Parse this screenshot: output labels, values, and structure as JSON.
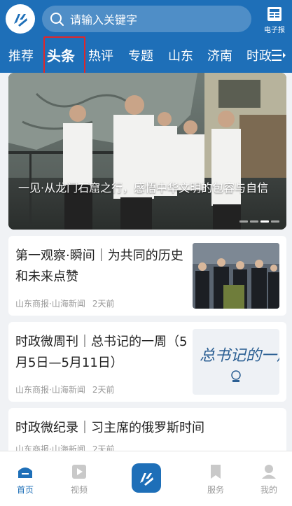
{
  "header": {
    "logo_text": "齐鲁",
    "search_placeholder": "请输入关键字",
    "epaper_label": "电子报",
    "tabs": [
      {
        "label": "推荐",
        "active": false
      },
      {
        "label": "头条",
        "active": true
      },
      {
        "label": "热评",
        "active": false
      },
      {
        "label": "专题",
        "active": false
      },
      {
        "label": "山东",
        "active": false
      },
      {
        "label": "济南",
        "active": false
      },
      {
        "label": "时政",
        "active": false
      }
    ]
  },
  "banner": {
    "caption": "一见·从龙门石窟之行，感悟中华文明的包容与自信",
    "slide_count": 4,
    "active_slide": 3
  },
  "articles": [
    {
      "title": "第一观察·瞬间｜为共同的历史和未来点赞",
      "source": "山东商报·山海新闻",
      "time": "2天前",
      "has_thumb": true
    },
    {
      "title": "时政微周刊｜总书记的一周（5月5日—5月11日）",
      "source": "山东商报·山海新闻",
      "time": "2天前",
      "has_thumb": true,
      "thumb_text": "总书记的一周"
    },
    {
      "title": "时政微纪录｜习主席的俄罗斯时间",
      "source": "山东商报·山海新闻",
      "time": "2天前",
      "has_thumb": false
    }
  ],
  "bottom_nav": {
    "items": [
      {
        "label": "首页",
        "icon": "home-icon",
        "active": true
      },
      {
        "label": "视频",
        "icon": "video-icon",
        "active": false
      },
      {
        "label": "服务",
        "icon": "bookmark-icon",
        "active": false
      },
      {
        "label": "我的",
        "icon": "user-icon",
        "active": false
      }
    ],
    "center_text": "齐鲁"
  },
  "colors": {
    "brand": "#1e6fb8",
    "highlight": "#e0262a"
  }
}
